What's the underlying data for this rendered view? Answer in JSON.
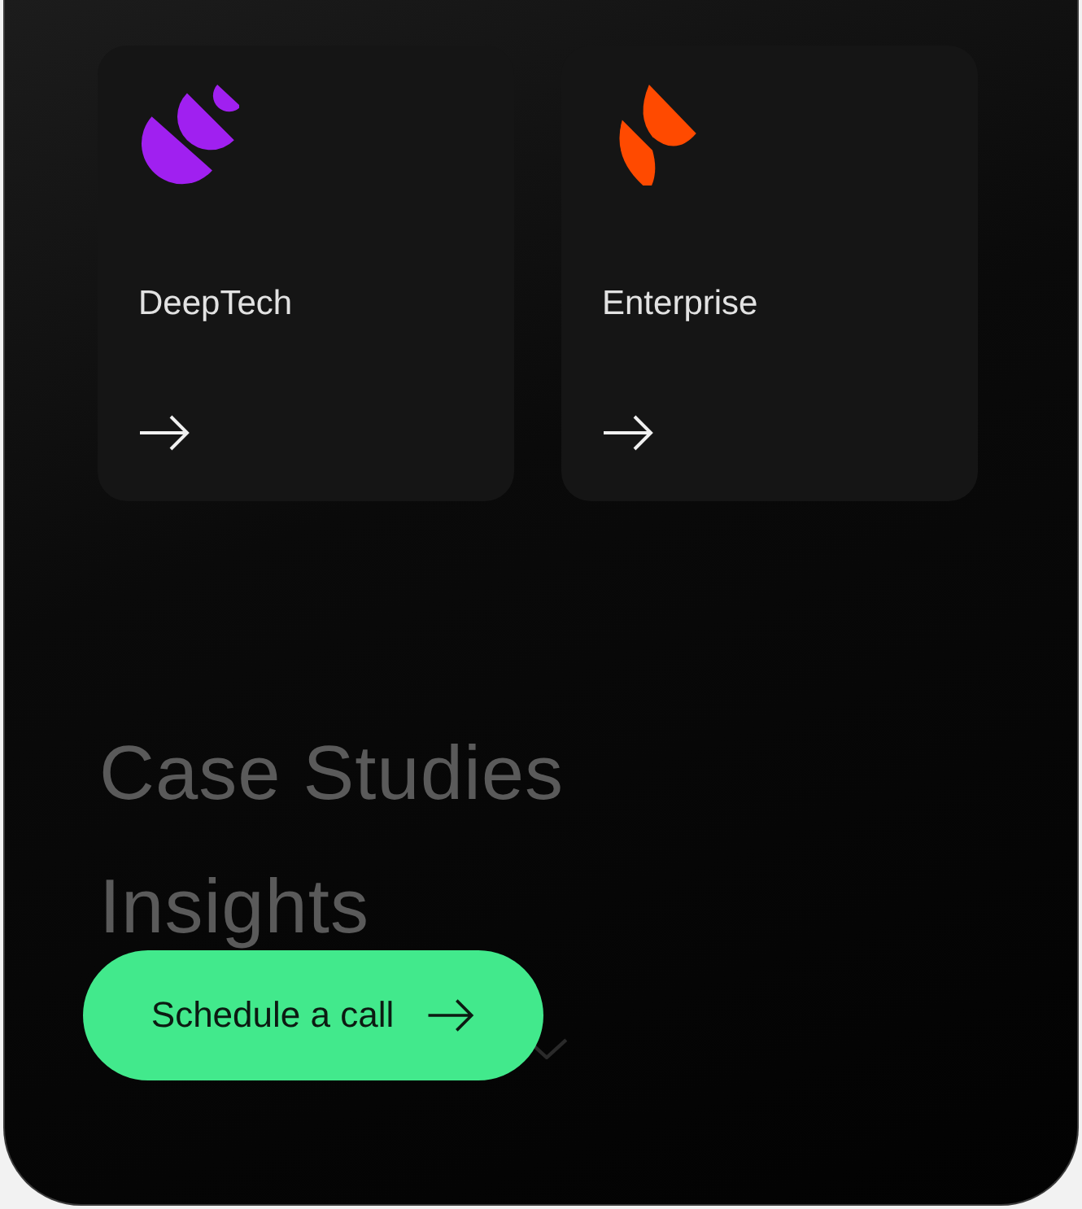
{
  "cards": [
    {
      "label": "DeepTech",
      "kind": "segments",
      "color": "#a020f0"
    },
    {
      "label": "Enterprise",
      "kind": "leaves",
      "color": "#ff4a00"
    }
  ],
  "menu": [
    {
      "label": "Case Studies"
    },
    {
      "label": "Insights"
    }
  ],
  "cta": {
    "label": "Schedule a call"
  }
}
